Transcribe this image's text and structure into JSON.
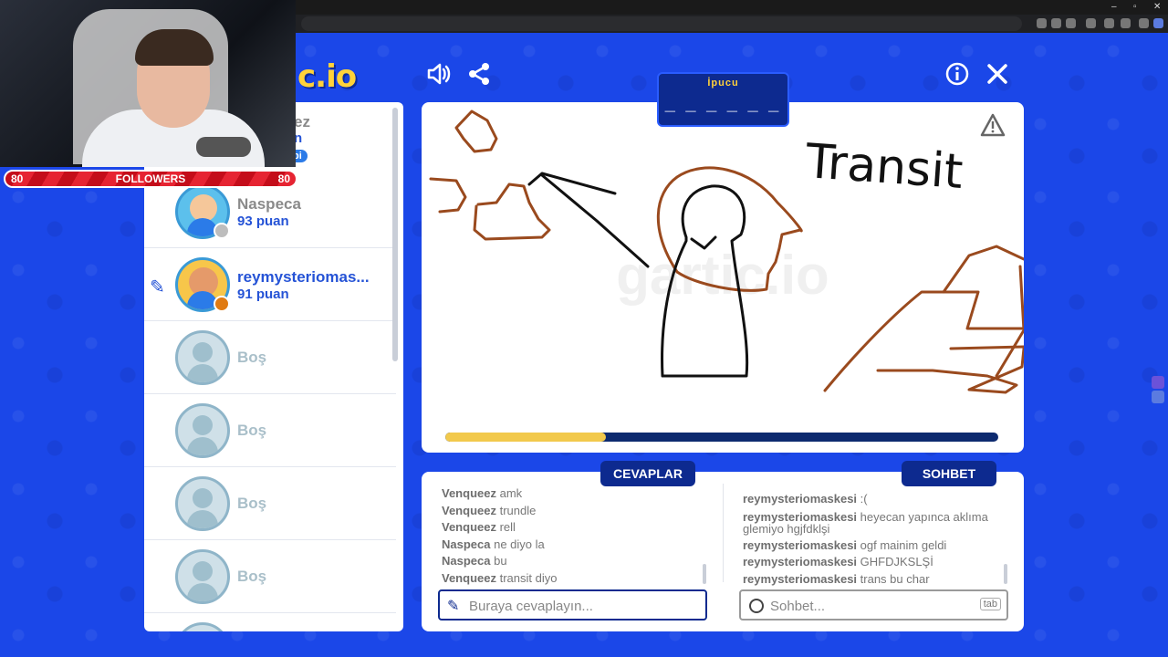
{
  "webcam": {
    "followers_left": "80",
    "followers_label": "FOLLOWERS",
    "followers_right": "80"
  },
  "logo": "c.io",
  "hint": {
    "label": "İpucu",
    "blanks": "_ _ _ _ _ _ _"
  },
  "players": {
    "partial": {
      "name": "ez",
      "score": "n",
      "badge": "ibi"
    },
    "list": [
      {
        "name": "Naspeca",
        "score": "93 puan"
      },
      {
        "name": "reymysteriomas...",
        "score": "91 puan"
      },
      {
        "name": "Boş"
      },
      {
        "name": "Boş"
      },
      {
        "name": "Boş"
      },
      {
        "name": "Boş"
      }
    ]
  },
  "canvas": {
    "drawn_text": "Transit",
    "watermark": "gartic.io",
    "progress_fraction": 0.29
  },
  "answers": {
    "tab": "CEVAPLAR",
    "messages": [
      {
        "user": "Venqueez",
        "text": "amk"
      },
      {
        "user": "Venqueez",
        "text": "trundle"
      },
      {
        "user": "Venqueez",
        "text": "rell"
      },
      {
        "user": "Naspeca",
        "text": "ne diyo la"
      },
      {
        "user": "Naspeca",
        "text": "bu"
      },
      {
        "user": "Venqueez",
        "text": "transit diyo"
      }
    ],
    "placeholder": "Buraya cevaplayın..."
  },
  "chat": {
    "tab": "SOHBET",
    "messages": [
      {
        "user": "reymysteriomaskesi",
        "text": ":("
      },
      {
        "user": "reymysteriomaskesi",
        "text": "heyecan yapınca aklıma glemiyo hgjfdklşi"
      },
      {
        "user": "reymysteriomaskesi",
        "text": "ogf mainim geldi"
      },
      {
        "user": "reymysteriomaskesi",
        "text": "GHFDJKSLŞİ"
      },
      {
        "user": "reymysteriomaskesi",
        "text": "trans bu char"
      }
    ],
    "placeholder": "Sohbet...",
    "tab_key": "tab"
  },
  "colors": {
    "background": "#1b47e8",
    "panel_dark": "#0d2a8f",
    "accent_yellow": "#f2c94c",
    "drawing_brown": "#9a4a1e"
  }
}
